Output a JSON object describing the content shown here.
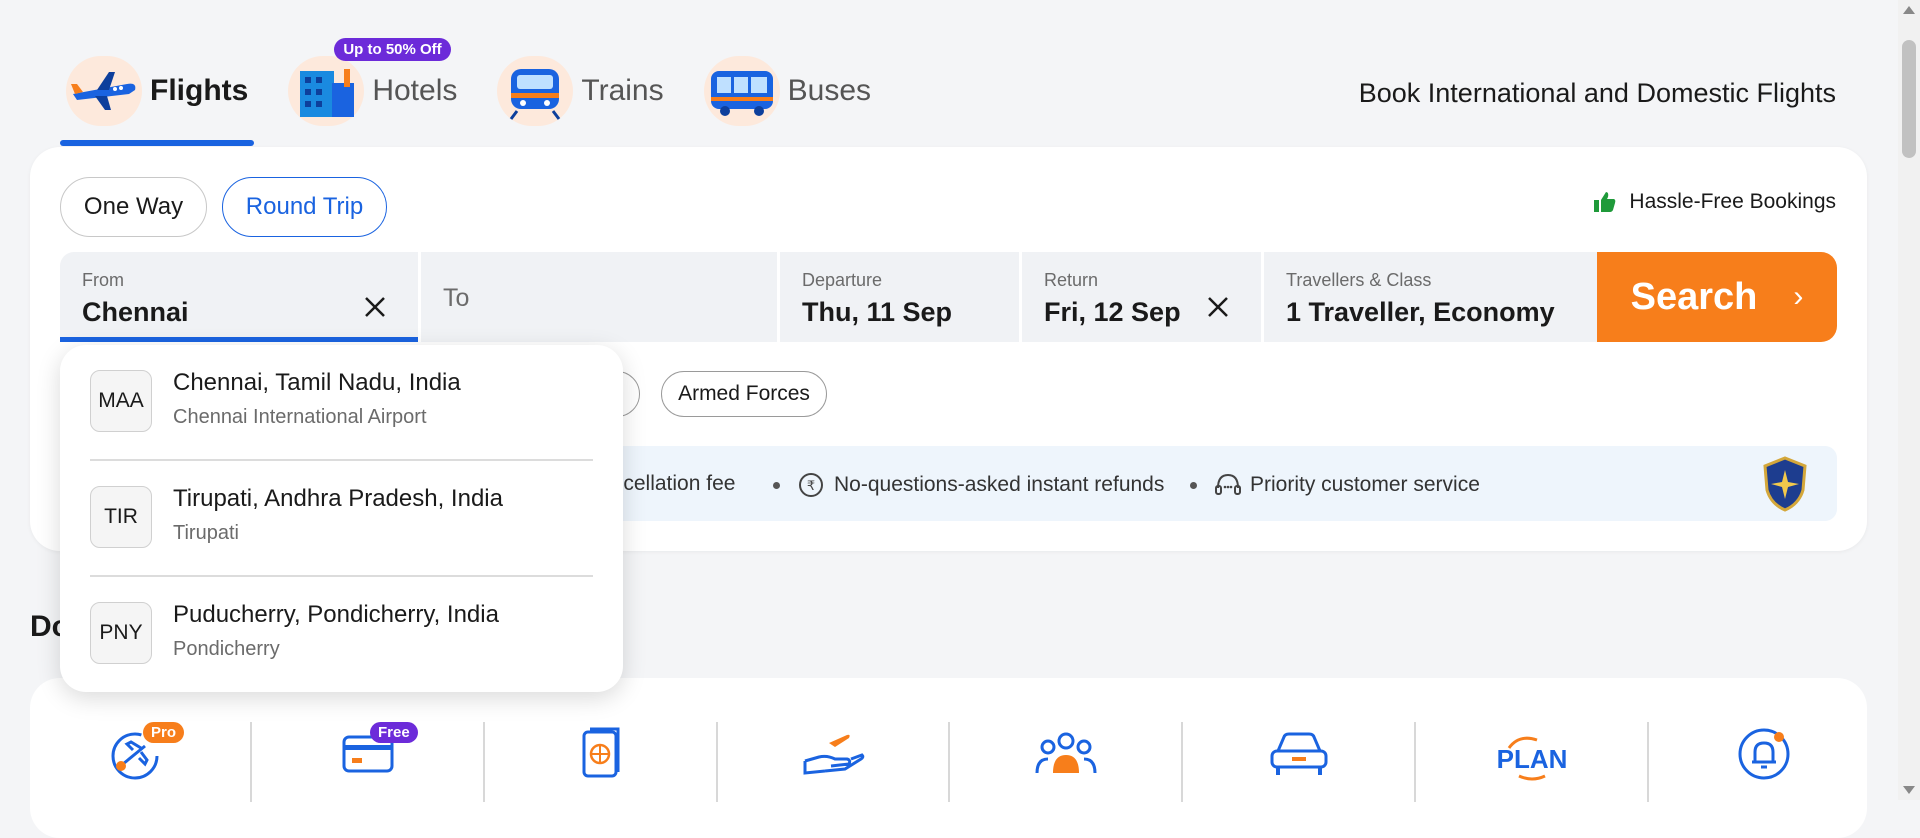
{
  "tabs": [
    {
      "label": "Flights",
      "active": true,
      "icon": "airplane-icon"
    },
    {
      "label": "Hotels",
      "active": false,
      "icon": "hotel-building-icon",
      "promo": "Up to 50% Off"
    },
    {
      "label": "Trains",
      "active": false,
      "icon": "train-icon"
    },
    {
      "label": "Buses",
      "active": false,
      "icon": "bus-icon"
    }
  ],
  "header": {
    "tagline": "Book International and Domestic Flights"
  },
  "trip_type": {
    "one_way": "One Way",
    "round_trip": "Round Trip",
    "selected": "Round Trip"
  },
  "hassle_free": "Hassle-Free Bookings",
  "search_form": {
    "from": {
      "label": "From",
      "value": "Chennai"
    },
    "to": {
      "placeholder": "To"
    },
    "departure": {
      "label": "Departure",
      "value": "Thu, 11 Sep"
    },
    "return": {
      "label": "Return",
      "value": "Fri, 12 Sep"
    },
    "travellers": {
      "label": "Travellers & Class",
      "value": "1 Traveller, Economy"
    },
    "search_label": "Search"
  },
  "fare_chips": [
    "Armed Forces"
  ],
  "benefits": [
    {
      "text": "ancellation fee"
    },
    {
      "text": "No-questions-asked instant refunds",
      "icon": "rupee-refund-icon"
    },
    {
      "text": "Priority customer service",
      "icon": "headset-icon"
    }
  ],
  "suggestions": [
    {
      "code": "MAA",
      "city": "Chennai, Tamil Nadu, India",
      "airport": "Chennai International Airport"
    },
    {
      "code": "TIR",
      "city": "Tirupati, Andhra Pradesh, India",
      "airport": "Tirupati"
    },
    {
      "code": "PNY",
      "city": "Puducherry, Pondicherry, India",
      "airport": "Pondicherry"
    }
  ],
  "section_heading": "Do",
  "services": [
    {
      "icon": "flight-pro-icon",
      "badge": "Pro"
    },
    {
      "icon": "card-icon",
      "badge": "Free"
    },
    {
      "icon": "passport-icon"
    },
    {
      "icon": "hand-plane-icon"
    },
    {
      "icon": "group-icon"
    },
    {
      "icon": "car-icon"
    },
    {
      "icon": "plan-icon",
      "text": "PLAN"
    },
    {
      "icon": "bell-icon"
    }
  ],
  "colors": {
    "primary": "#1a63e0",
    "search": "#f77e1b",
    "promo": "#6c2bd9",
    "badge_orange": "#f77e1b"
  }
}
